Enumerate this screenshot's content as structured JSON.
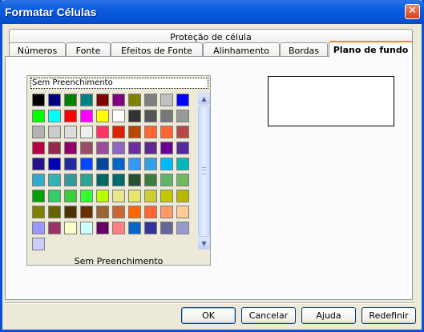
{
  "window": {
    "title": "Formatar Células",
    "close_glyph": "✕"
  },
  "tabs_row1": [
    {
      "label": "Proteção de célula"
    }
  ],
  "tabs_row2": [
    {
      "label": "Números"
    },
    {
      "label": "Fonte"
    },
    {
      "label": "Efeitos de Fonte"
    },
    {
      "label": "Alinhamento"
    },
    {
      "label": "Bordas"
    },
    {
      "label": "Plano de fundo",
      "active": true
    }
  ],
  "background": {
    "no_fill_label": "Sem Preenchimento",
    "caption": "Sem Preenchimento",
    "preview_color": "#FFFFFF",
    "palette": [
      "#000000",
      "#000080",
      "#008000",
      "#008080",
      "#800000",
      "#800080",
      "#808000",
      "#808080",
      "#C0C0C0",
      "#0000FF",
      "#00FF00",
      "#00FFFF",
      "#FF0000",
      "#FF00FF",
      "#FFFF00",
      "#FFFFFF",
      "#333333",
      "#555555",
      "#777777",
      "#999999",
      "#B2B2B2",
      "#CCCCCC",
      "#DDDDDD",
      "#EEEEEE",
      "#FF3366",
      "#DC2300",
      "#B84700",
      "#FF6633",
      "#FF6633",
      "#B84747",
      "#B80047",
      "#99284D",
      "#94006B",
      "#994D66",
      "#9A4D9A",
      "#8E68BF",
      "#6B2FA0",
      "#5E2B8C",
      "#6B0094",
      "#5528A0",
      "#23148C",
      "#0000B8",
      "#23299E",
      "#0047FF",
      "#004799",
      "#0066CC",
      "#3399FF",
      "#33A0E6",
      "#00B8FF",
      "#00B8B8",
      "#33AACC",
      "#33B2B2",
      "#339999",
      "#2EA38F",
      "#006666",
      "#006B6B",
      "#285030",
      "#3D7D40",
      "#61B26A",
      "#71B85E",
      "#00A000",
      "#33CC66",
      "#3ACC3A",
      "#33FF33",
      "#B8FF00",
      "#E8E88B",
      "#E6E66E",
      "#CCCC33",
      "#C7C700",
      "#B8B800",
      "#808000",
      "#666600",
      "#4D3300",
      "#663300",
      "#996633",
      "#CC6633",
      "#FF6600",
      "#FF6633",
      "#FF9966",
      "#FFCC99",
      "#9999FF",
      "#993366",
      "#FFFFCC",
      "#CCFFFF",
      "#660066",
      "#FF8080",
      "#0066CC",
      "#333399",
      "#666699",
      "#9999CC",
      "#CCCCFF"
    ],
    "scroll_up_glyph": "▲",
    "scroll_down_glyph": "▼"
  },
  "buttons": {
    "ok": "OK",
    "cancel": "Cancelar",
    "help": "Ajuda",
    "reset": "Redefinir"
  }
}
